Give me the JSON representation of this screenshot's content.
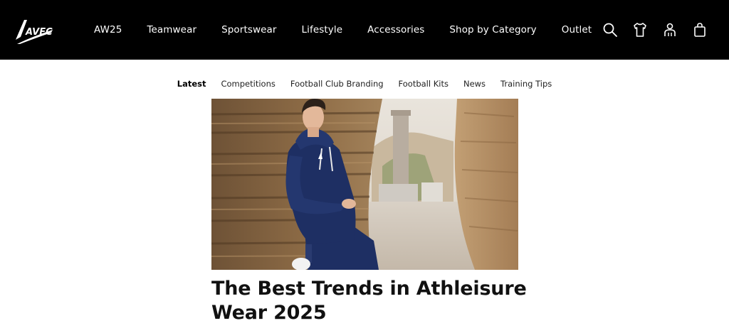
{
  "brand": {
    "logo_text": "AVEC"
  },
  "nav": {
    "items": [
      {
        "label": "AW25"
      },
      {
        "label": "Teamwear"
      },
      {
        "label": "Sportswear"
      },
      {
        "label": "Lifestyle"
      },
      {
        "label": "Accessories"
      },
      {
        "label": "Shop by Category"
      },
      {
        "label": "Outlet"
      }
    ]
  },
  "header_icons": [
    "search-icon",
    "shirt-icon",
    "account-icon",
    "bag-icon"
  ],
  "subnav": {
    "items": [
      {
        "label": "Latest",
        "active": true
      },
      {
        "label": "Competitions"
      },
      {
        "label": "Football Club Branding"
      },
      {
        "label": "Football Kits"
      },
      {
        "label": "News"
      },
      {
        "label": "Training Tips"
      }
    ]
  },
  "article": {
    "title": "The Best Trends in Athleisure Wear 2025"
  },
  "colors": {
    "header_bg": "#000000",
    "text": "#111111",
    "page_bg": "#ffffff",
    "hoodie": "#1e2f63"
  }
}
